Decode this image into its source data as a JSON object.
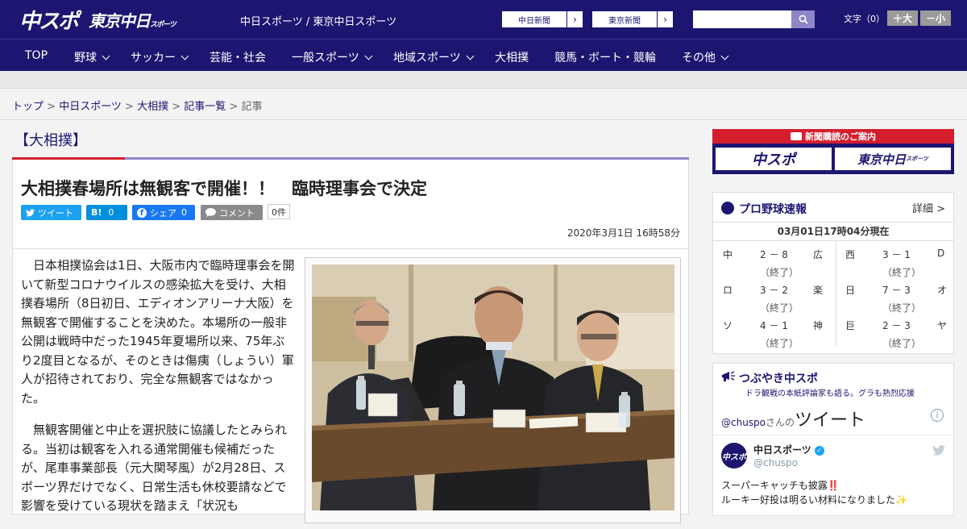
{
  "header": {
    "logo_main": "中スポ",
    "logo_tokyo": "東京中日",
    "logo_tokyo_small": "スポーツ",
    "site_title": "中日スポーツ / 東京中日スポーツ",
    "ext_links": [
      {
        "label": "中日新聞",
        "arrow": "›"
      },
      {
        "label": "東京新聞",
        "arrow": "›"
      }
    ],
    "search_placeholder": "",
    "font_size_label": "文字（0）",
    "font_plus": "＋大",
    "font_minus": "－小"
  },
  "nav": {
    "items": [
      {
        "label": "TOP"
      },
      {
        "label": "野球"
      },
      {
        "label": "サッカー"
      },
      {
        "label": "芸能・社会"
      },
      {
        "label": "一般スポーツ"
      },
      {
        "label": "地域スポーツ"
      },
      {
        "label": "大相撲"
      },
      {
        "label": "競馬・ボート・競輪"
      },
      {
        "label": "その他"
      }
    ]
  },
  "breadcrumb": {
    "items": [
      "トップ",
      "中日スポーツ",
      "大相撲",
      "記事一覧",
      "記事"
    ],
    "separator": " > "
  },
  "article": {
    "category": "【大相撲】",
    "headline": "大相撲春場所は無観客で開催！！　臨時理事会で決定",
    "social": {
      "tweet": "ツイート",
      "hatena": "B!",
      "hatena_count": "0",
      "facebook": "シェア",
      "facebook_count": "0",
      "comment": "コメント",
      "comment_count": "0件"
    },
    "date": "2020年3月1日 16時58分",
    "paragraphs": [
      "日本相撲協会は1日、大阪市内で臨時理事会を開いて新型コロナウイルスの感染拡大を受け、大相撲春場所（8日初日、エディオンアリーナ大阪）を無観客で開催することを決めた。本場所の一般非公開は戦時中だった1945年夏場所以来、75年ぶり2度目となるが、そのときは傷痍（しょうい）軍人が招待されており、完全な無観客ではなかった。",
      "無観客開催と中止を選択肢に協議したとみられる。当初は観客を入れる通常開催も候補だったが、尾車事業部長（元大関琴風）が2月28日、スポーツ界だけでなく、日常生活も休校要請などで影響を受けている現状を踏まえ「状況も"
    ]
  },
  "sidebar": {
    "promo_title": "新聞購読のご案内",
    "promo_left": "中スポ",
    "promo_right": "東京中日",
    "promo_right_small": "スポーツ",
    "baseball": {
      "title": "プロ野球速報",
      "detail": "詳細 >",
      "updated": "03月01日17時04分現在",
      "games": [
        {
          "home": "中",
          "score": "2 － 8",
          "away": "広",
          "status": "（終了）"
        },
        {
          "home": "ロ",
          "score": "3 － 2",
          "away": "楽",
          "status": "（終了）"
        },
        {
          "home": "ソ",
          "score": "4 － 1",
          "away": "神",
          "status": "（終了）"
        },
        {
          "home": "西",
          "score": "3 － 1",
          "away": "D",
          "status": "（終了）"
        },
        {
          "home": "日",
          "score": "7 － 3",
          "away": "オ",
          "status": "（終了）"
        },
        {
          "home": "巨",
          "score": "2 － 3",
          "away": "ヤ",
          "status": "（終了）"
        }
      ]
    },
    "twitter": {
      "title": "つぶやき中スポ",
      "subtitle": "ドラ観戦の本紙評論家も語る。グラも熱烈応援",
      "handle_prefix": "@chuspo",
      "handle_suffix": "さんの",
      "tweets_label": "ツイート",
      "info": "i",
      "name": "中日スポーツ",
      "handle": "@chuspo",
      "avatar_text": "中スポ",
      "text_line1": "スーパーキャッチも披露‼️",
      "text_line2": "ルーキー好投は明るい材料になりました✨"
    }
  },
  "colors": {
    "brand": "#1d1670",
    "accent_red": "#d41e2e",
    "twitter": "#1da1f2",
    "hatena": "#008fde",
    "facebook": "#1877f2",
    "comment": "#8a8a8a"
  }
}
